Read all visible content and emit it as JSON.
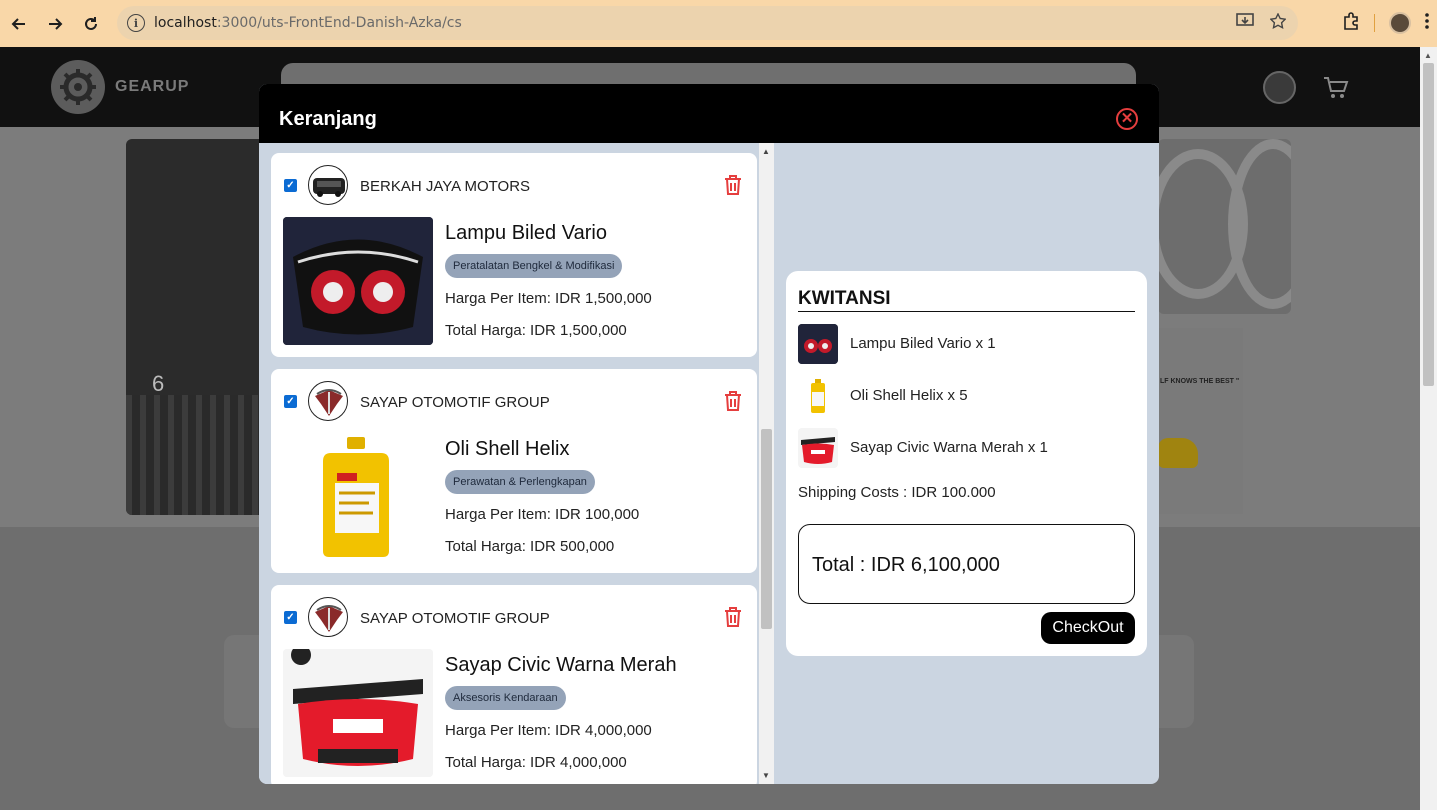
{
  "browser": {
    "url_host": "localhost",
    "url_rest": ":3000/uts-FrontEnd-Danish-Azka/cs"
  },
  "site": {
    "brand": "GEARUP",
    "hero_number": "6",
    "promo_text": "LF KNOWS THE BEST \""
  },
  "modal": {
    "title": "Keranjang",
    "close_icon": "close-circle-icon"
  },
  "cart": {
    "items": [
      {
        "shop": "BERKAH JAYA MOTORS",
        "name": "Lampu Biled Vario",
        "category": "Peratalatan Bengkel & Modifikasi",
        "price_line": "Harga Per Item: IDR 1,500,000",
        "total_line": "Total Harga: IDR 1,500,000",
        "checked": true
      },
      {
        "shop": "SAYAP OTOMOTIF GROUP",
        "name": "Oli Shell Helix",
        "category": "Perawatan & Perlengkapan",
        "price_line": "Harga Per Item: IDR 100,000",
        "total_line": "Total Harga: IDR 500,000",
        "checked": true
      },
      {
        "shop": "SAYAP OTOMOTIF GROUP",
        "name": "Sayap Civic Warna Merah",
        "category": "Aksesoris Kendaraan",
        "price_line": "Harga Per Item: IDR 4,000,000",
        "total_line": "Total Harga: IDR 4,000,000",
        "checked": true
      }
    ]
  },
  "receipt": {
    "title": "KWITANSI",
    "items": [
      "Lampu Biled Vario x 1",
      "Oli Shell Helix x 5",
      "Sayap Civic Warna Merah x 1"
    ],
    "shipping": "Shipping Costs : IDR 100.000",
    "total": "Total : IDR 6,100,000",
    "checkout_label": "CheckOut"
  },
  "colors": {
    "accent_danger": "#e53e3e",
    "modal_bg": "#cbd5e1",
    "category_pill": "#94a3b8",
    "checkbox": "#0b6bd3"
  }
}
